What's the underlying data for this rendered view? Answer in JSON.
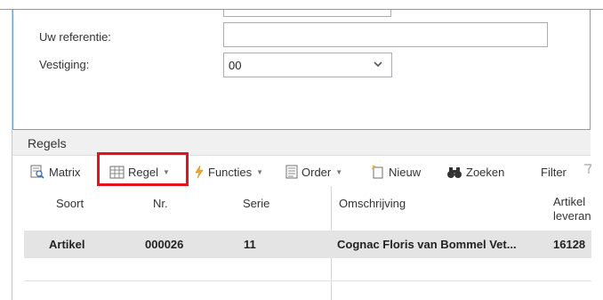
{
  "form": {
    "reference_label": "Uw referentie:",
    "reference_value": "",
    "branch_label": "Vestiging:",
    "branch_value": "00"
  },
  "lines_section": {
    "title": "Regels"
  },
  "toolbar": {
    "matrix": "Matrix",
    "regel": "Regel",
    "functies": "Functies",
    "order": "Order",
    "nieuw": "Nieuw",
    "zoeken": "Zoeken",
    "filter": "Filter"
  },
  "table": {
    "columns": {
      "soort": "Soort",
      "nr": "Nr.",
      "serie": "Serie",
      "omschrijving": "Omschrijving",
      "artikel_line1": "Artikel",
      "artikel_line2": "leveran"
    },
    "rows": [
      {
        "soort": "Artikel",
        "nr": "000026",
        "serie": "11",
        "omschrijving": "Cognac Floris van Bommel Vet...",
        "artikel": "16128"
      }
    ]
  },
  "colors": {
    "highlight": "#e0141e",
    "section_border": "#6ea5d9",
    "selected_row": "#e4e4e4"
  }
}
